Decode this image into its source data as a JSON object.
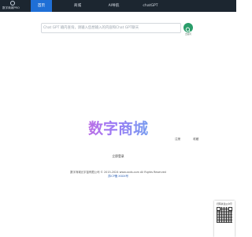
{
  "header": {
    "logo_text": "数字商城PRO",
    "nav": [
      {
        "label": "首页",
        "active": true
      },
      {
        "label": "商城",
        "active": false
      },
      {
        "label": "AI导航",
        "active": false
      },
      {
        "label": "chatGPT",
        "active": false
      }
    ]
  },
  "search": {
    "placeholder": "Chat GPT 输内查询，请输入您想输入的内容和Chat GPT聊天",
    "button_label": "去提问"
  },
  "hero": {
    "title": "数字商城",
    "sub": "立即登录",
    "links": [
      "注册",
      "收藏"
    ]
  },
  "footer": {
    "company": "数字商城元宇宙有限公司 © 2015-2024 www.xxds.com All Rights Reserved",
    "icp": "苏ICP备 XXXX号"
  },
  "qr": {
    "title": "扫码关注公众号"
  },
  "colors": {
    "nav_active": "#1f6fd6",
    "topbar": "#1c2630",
    "search_button": "#2a9d6a"
  }
}
